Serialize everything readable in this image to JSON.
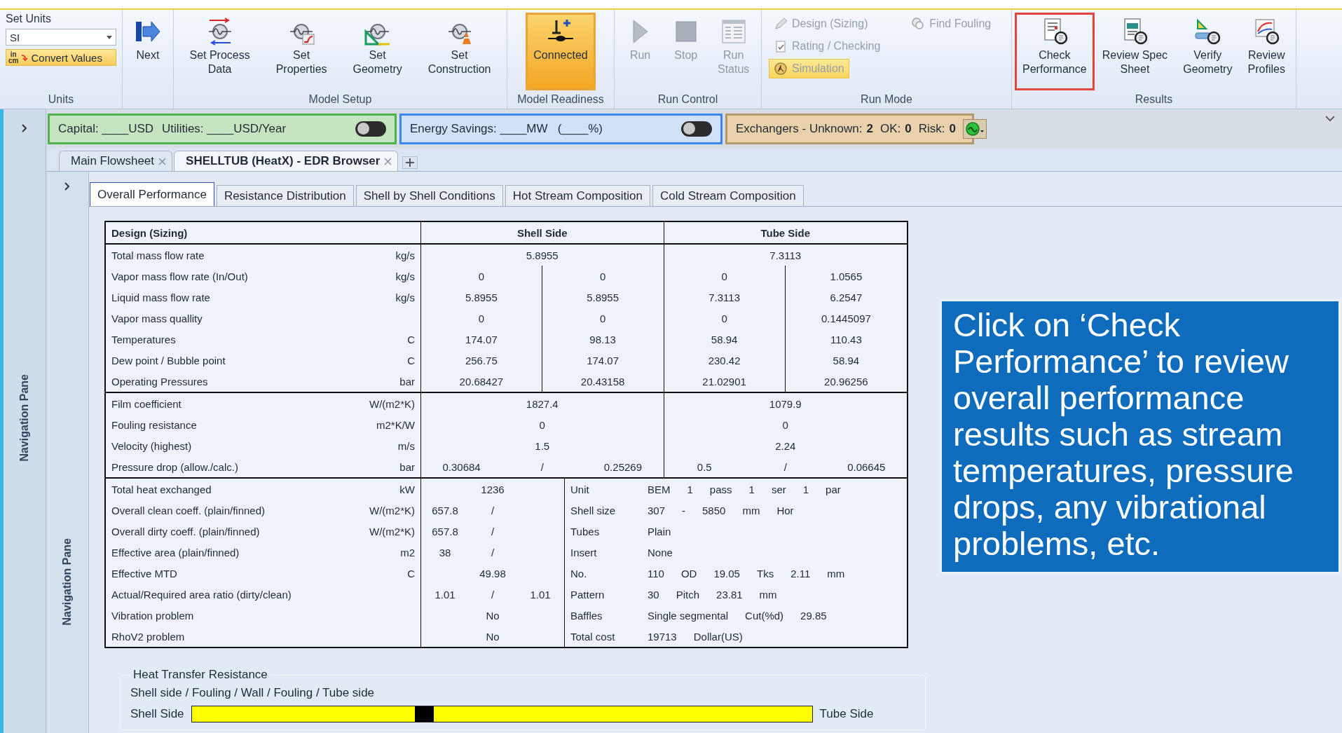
{
  "ribbon": {
    "groups": [
      {
        "kind": "units",
        "label": "Units",
        "title": "Set Units",
        "unit_select": {
          "value": "SI"
        },
        "convert": {
          "label": "Convert Values",
          "icon_top": "in",
          "icon_bottom": "cm"
        }
      },
      {
        "kind": "large",
        "buttons": [
          {
            "label": "Next",
            "disabled": false,
            "active": false,
            "highlighted": false
          }
        ]
      },
      {
        "kind": "large",
        "label": "Model Setup",
        "buttons": [
          {
            "label": "Set Process\nData",
            "disabled": false,
            "active": false,
            "highlighted": false
          },
          {
            "label": "Set\nProperties",
            "disabled": false,
            "active": false,
            "highlighted": false
          },
          {
            "label": "Set\nGeometry",
            "disabled": false,
            "active": false,
            "highlighted": false
          },
          {
            "label": "Set\nConstruction",
            "disabled": false,
            "active": false,
            "highlighted": false
          }
        ]
      },
      {
        "kind": "large",
        "label": "Model Readiness",
        "buttons": [
          {
            "label": "Connected",
            "disabled": false,
            "active": true,
            "highlighted": false
          }
        ]
      },
      {
        "kind": "large",
        "label": "Run Control",
        "buttons": [
          {
            "label": "Run",
            "disabled": true,
            "active": false,
            "highlighted": false
          },
          {
            "label": "Stop",
            "disabled": true,
            "active": false,
            "highlighted": false
          },
          {
            "label": "Run\nStatus",
            "disabled": true,
            "active": false,
            "highlighted": false
          }
        ]
      },
      {
        "kind": "modes",
        "label": "Run Mode",
        "modes": [
          {
            "label": "Design (Sizing)",
            "selected": false,
            "disabled": true
          },
          {
            "label": "Rating / Checking",
            "selected": false,
            "disabled": true
          },
          {
            "label": "Simulation",
            "selected": true,
            "disabled": true
          },
          {
            "label": "Find Fouling",
            "selected": false,
            "disabled": true
          }
        ]
      },
      {
        "kind": "large",
        "label": "Results",
        "buttons": [
          {
            "label": "Check\nPerformance",
            "disabled": false,
            "active": false,
            "highlighted": true
          },
          {
            "label": "Review Spec\nSheet",
            "disabled": false,
            "active": false,
            "highlighted": false
          },
          {
            "label": "Verify\nGeometry",
            "disabled": false,
            "active": false,
            "highlighted": false
          },
          {
            "label": "Review\nProfiles",
            "disabled": false,
            "active": false,
            "highlighted": false
          }
        ]
      }
    ]
  },
  "navigation_pane": {
    "label": "Navigation Pane"
  },
  "status_bar": {
    "cost": {
      "capital": "Capital: ____USD",
      "utilities": "Utilities: ____USD/Year",
      "toggle_on": false
    },
    "energy": {
      "text": "Energy Savings: ____MW   (____%)",
      "toggle_on": false
    },
    "exchangers": [
      {
        "label": "Exchangers - Unknown:",
        "value": "2"
      },
      {
        "label": "OK:",
        "value": "0"
      },
      {
        "label": "Risk:",
        "value": "0"
      }
    ]
  },
  "document_tabs": [
    {
      "label": "Main Flowsheet",
      "selected": false
    },
    {
      "label": "SHELLTUB (HeatX) - EDR Browser",
      "selected": true
    }
  ],
  "inner_navigation_pane": {
    "label": "Navigation Pane"
  },
  "tabs": [
    {
      "label": "Overall Performance",
      "selected": true
    },
    {
      "label": "Resistance Distribution",
      "selected": false
    },
    {
      "label": "Shell by Shell Conditions",
      "selected": false
    },
    {
      "label": "Hot Stream Composition",
      "selected": false
    },
    {
      "label": "Cold Stream Composition",
      "selected": false
    }
  ],
  "table": {
    "header": {
      "title": "Design (Sizing)",
      "shell": "Shell Side",
      "tube": "Tube Side"
    },
    "sections": [
      {
        "kind": "sides",
        "rows": [
          {
            "label": "Total mass flow rate",
            "unit": "kg/s",
            "shell": [
              "5.8955"
            ],
            "tube": [
              "7.3113"
            ]
          },
          {
            "label": "Vapor mass flow rate (In/Out)",
            "unit": "kg/s",
            "shell": [
              "0",
              "0"
            ],
            "tube": [
              "0",
              "1.0565"
            ]
          },
          {
            "label": "Liquid mass flow rate",
            "unit": "kg/s",
            "shell": [
              "5.8955",
              "5.8955"
            ],
            "tube": [
              "7.3113",
              "6.2547"
            ]
          },
          {
            "label": "Vapor mass quallity",
            "shell": [
              "0",
              "0"
            ],
            "tube": [
              "0",
              "0.1445097"
            ]
          },
          {
            "label": "Temperatures",
            "unit": "C",
            "shell": [
              "174.07",
              "98.13"
            ],
            "tube": [
              "58.94",
              "110.43"
            ]
          },
          {
            "label": "Dew point / Bubble point",
            "unit": "C",
            "shell": [
              "256.75",
              "174.07"
            ],
            "tube": [
              "230.42",
              "58.94"
            ]
          },
          {
            "label": "Operating Pressures",
            "unit": "bar",
            "shell": [
              "20.68427",
              "20.43158"
            ],
            "tube": [
              "21.02901",
              "20.96256"
            ]
          }
        ]
      },
      {
        "kind": "sides",
        "rows": [
          {
            "label": "Film coefficient",
            "unit": "W/(m2*K)",
            "shell": [
              "1827.4"
            ],
            "tube": [
              "1079.9"
            ]
          },
          {
            "label": "Fouling resistance",
            "unit": "m2*K/W",
            "shell": [
              "0"
            ],
            "tube": [
              "0"
            ]
          },
          {
            "label": "Velocity (highest)",
            "unit": "m/s",
            "shell": [
              "1.5"
            ],
            "tube": [
              "2.24"
            ]
          },
          {
            "label": "Pressure drop (allow./calc.)",
            "unit": "bar",
            "shell": [
              "0.30684",
              "/",
              "0.25269"
            ],
            "tube": [
              "0.5",
              "/",
              "0.06645"
            ]
          }
        ]
      },
      {
        "kind": "summary",
        "rows": [
          {
            "label": "Total heat exchanged",
            "unit": "kW",
            "values": [
              "1236"
            ],
            "details": [
              "Unit",
              "BEM",
              "1",
              "pass",
              "1",
              "ser",
              "1",
              "par"
            ]
          },
          {
            "label": "Overall clean coeff. (plain/finned)",
            "unit": "W/(m2*K)",
            "values": [
              "657.8",
              "/"
            ],
            "details": [
              "Shell size",
              "307",
              "-",
              "5850",
              "mm",
              "Hor"
            ]
          },
          {
            "label": "Overall dirty coeff. (plain/finned)",
            "unit": "W/(m2*K)",
            "values": [
              "657.8",
              "/"
            ],
            "details": [
              "Tubes",
              "Plain"
            ]
          },
          {
            "label": "Effective area (plain/finned)",
            "unit": "m2",
            "values": [
              "38",
              "/"
            ],
            "details": [
              "Insert",
              "None"
            ]
          },
          {
            "label": "Effective MTD",
            "unit": "C",
            "values": [
              "49.98"
            ],
            "details": [
              "No.",
              "110",
              "OD",
              "19.05",
              "Tks",
              "2.11",
              "mm"
            ]
          },
          {
            "label": "Actual/Required area ratio (dirty/clean)",
            "values": [
              "1.01",
              "/",
              "1.01"
            ],
            "details": [
              "Pattern",
              "30",
              "Pitch",
              "23.81",
              "mm"
            ]
          },
          {
            "label": "Vibration problem",
            "values": [
              "No"
            ],
            "details": [
              "Baffles",
              "Single segmental",
              "Cut(%d)",
              "29.85"
            ]
          },
          {
            "label": "RhoV2 problem",
            "values": [
              "No"
            ],
            "details": [
              "Total cost",
              "19713",
              "Dollar(US)"
            ]
          }
        ]
      }
    ]
  },
  "callout": {
    "text": "Click on ‘Check Performance’ to review overall performance results such as stream temperatures, pressure drops, any vibrational problems, etc."
  },
  "heat_transfer_resistance": {
    "title": "Heat Transfer Resistance",
    "caption": "Shell side / Fouling / Wall / Fouling / Tube side",
    "left_label": "Shell Side",
    "right_label": "Tube Side",
    "segments": [
      {
        "level": 0.36,
        "color": "#ffff00"
      },
      {
        "level": 0.03,
        "color": "#000000"
      },
      {
        "level": 0.61,
        "color": "#ffff00"
      }
    ]
  }
}
